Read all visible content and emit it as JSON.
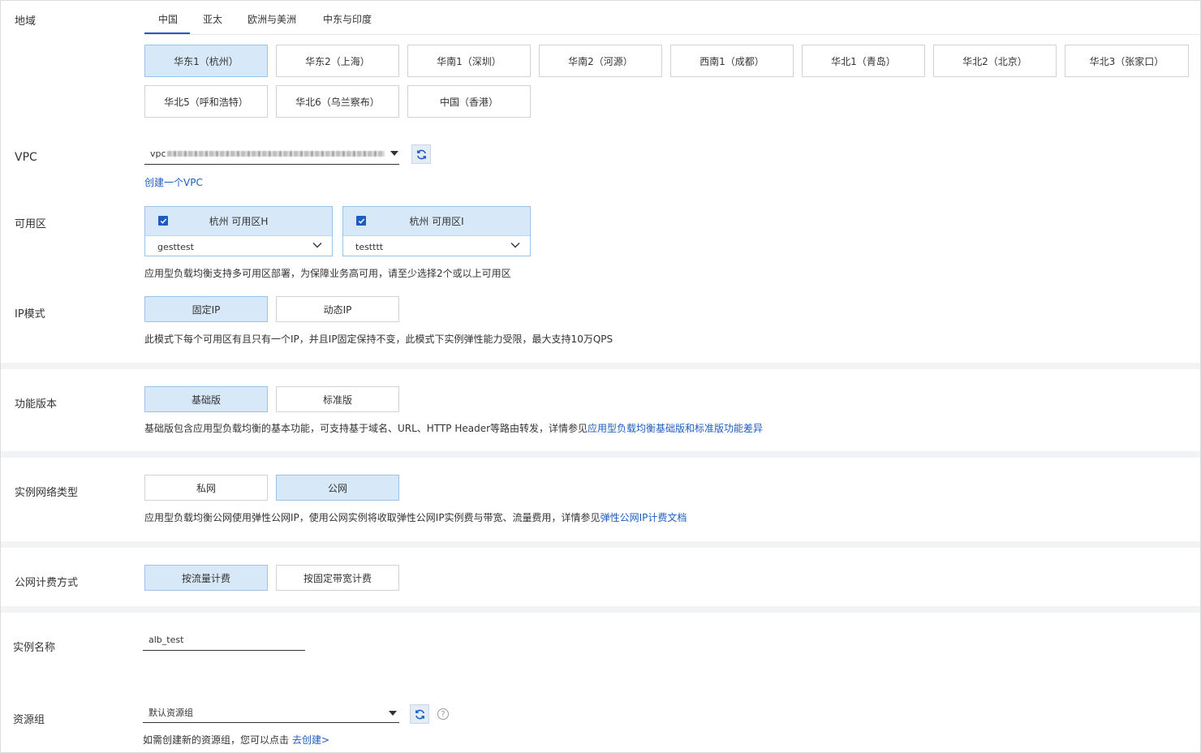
{
  "region": {
    "label": "地域",
    "tabs": [
      "中国",
      "亚太",
      "欧洲与美洲",
      "中东与印度"
    ],
    "options": [
      "华东1（杭州）",
      "华东2（上海）",
      "华南1（深圳）",
      "华南2（河源）",
      "西南1（成都）",
      "华北1（青岛）",
      "华北2（北京）",
      "华北3（张家口）",
      "华北5（呼和浩特）",
      "华北6（乌兰察布）",
      "中国（香港）"
    ],
    "selected": "华东1（杭州）"
  },
  "vpc": {
    "label": "VPC",
    "value_prefix": "vpc",
    "create_link": "创建一个VPC"
  },
  "zone": {
    "label": "可用区",
    "zones": [
      {
        "name": "杭州 可用区H",
        "vswitch": "gesttest"
      },
      {
        "name": "杭州 可用区I",
        "vswitch": "testttt"
      }
    ],
    "hint": "应用型负载均衡支持多可用区部署，为保障业务高可用，请至少选择2个或以上可用区"
  },
  "ip_mode": {
    "label": "IP模式",
    "options": [
      "固定IP",
      "动态IP"
    ],
    "selected": "固定IP",
    "hint": "此模式下每个可用区有且只有一个IP，并且IP固定保持不变，此模式下实例弹性能力受限，最大支持10万QPS"
  },
  "edition": {
    "label": "功能版本",
    "options": [
      "基础版",
      "标准版"
    ],
    "selected": "基础版",
    "hint": "基础版包含应用型负载均衡的基本功能，可支持基于域名、URL、HTTP Header等路由转发，详情参见",
    "hint_link": "应用型负载均衡基础版和标准版功能差异"
  },
  "network_type": {
    "label": "实例网络类型",
    "options": [
      "私网",
      "公网"
    ],
    "selected": "公网",
    "hint": "应用型负载均衡公网使用弹性公网IP，使用公网实例将收取弹性公网IP实例费与带宽、流量费用，详情参见",
    "hint_link": "弹性公网IP计费文档"
  },
  "billing": {
    "label": "公网计费方式",
    "options": [
      "按流量计费",
      "按固定带宽计费"
    ],
    "selected": "按流量计费"
  },
  "instance_name": {
    "label": "实例名称",
    "value": "alb_test"
  },
  "resource_group": {
    "label": "资源组",
    "value": "默认资源组",
    "hint": "如需创建新的资源组，您可以点击",
    "hint_link": "去创建>"
  },
  "colors": {
    "accent": "#1f5cbf",
    "selected_bg": "#d7e8f8",
    "section_gap": "#f2f3f5"
  }
}
